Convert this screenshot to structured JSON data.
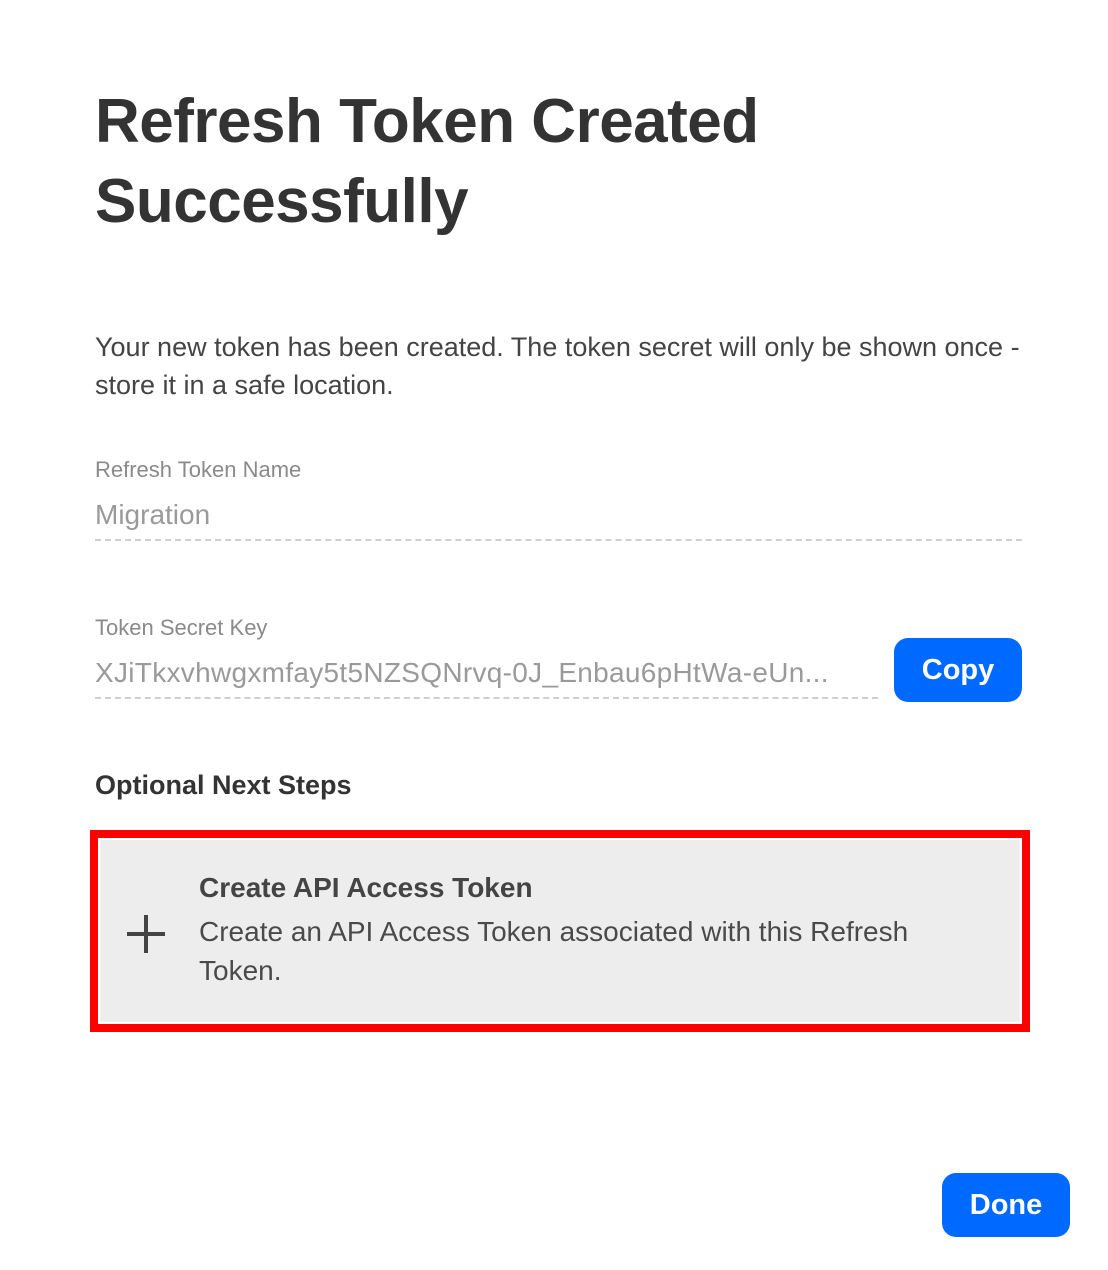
{
  "dialog": {
    "title": "Refresh Token Created Successfully",
    "intro": "Your new token has been created. The token secret will only be shown once - store it in a safe location."
  },
  "fields": {
    "name": {
      "label": "Refresh Token Name",
      "value": "Migration"
    },
    "secret": {
      "label": "Token Secret Key",
      "value": "XJiTkxvhwgxmfay5t5NZSQNrvq-0J_Enbau6pHtWa-eUn..."
    }
  },
  "buttons": {
    "copy_label": "Copy",
    "done_label": "Done"
  },
  "next_steps": {
    "heading": "Optional Next Steps",
    "items": [
      {
        "icon": "plus-icon",
        "title": "Create API Access Token",
        "description": "Create an API Access Token associated with this Refresh Token."
      }
    ]
  },
  "colors": {
    "primary_button": "#0069ff",
    "highlight_border": "#ff0000",
    "card_background": "#ededed"
  }
}
